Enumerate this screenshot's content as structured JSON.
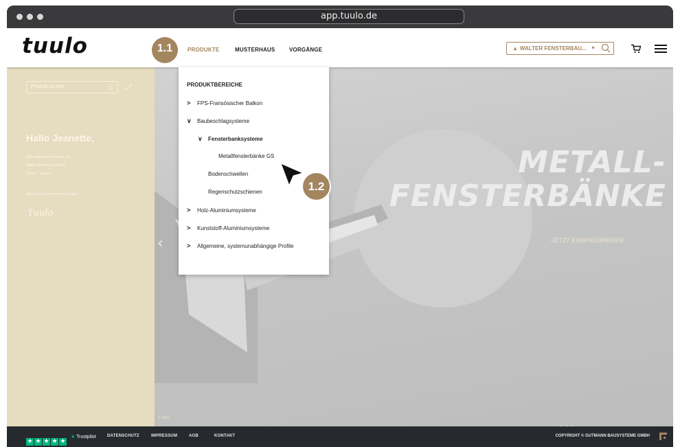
{
  "browser": {
    "url": "app.tuulo.de"
  },
  "header": {
    "logo": "tuulo",
    "step_badge": "1.1",
    "nav": [
      "PRODUKTE",
      "MUSTERHAUS",
      "VORGÄNGE"
    ],
    "user_select": {
      "value": "WALTER FENSTERBAU..."
    },
    "icons": [
      "person-icon",
      "caret-down-icon",
      "search-icon",
      "cart-icon",
      "menu-icon"
    ],
    "accent_color": "#a38660"
  },
  "sidebar": {
    "search_placeholder": "Produkt suchen",
    "greeting": "Hallo Jeanette,",
    "lines": [
      "dein ausgewählter Kunde ist:",
      "Walter Fensterbau GmbH",
      "Sorten · Stegen",
      "Viel Spaß in der neuen tuulo App!"
    ],
    "signature": "Tuulo",
    "footnote": "© 2020"
  },
  "hero": {
    "title_line1": "METALL-",
    "title_line2": "FENSTERBÄNKE",
    "cta": "JETZT KONFIGURIEREN",
    "slides": 3
  },
  "dropdown": {
    "heading": "PRODUKTBEREICHE",
    "items": [
      {
        "label": "FPS-Fransösischer Balkon",
        "icon": "chevron-right-icon"
      },
      {
        "label": "Baubeschlagsysteme",
        "icon": "chevron-down-icon"
      },
      {
        "label": "Fensterbanksysteme",
        "icon": "chevron-down-icon"
      },
      {
        "label": "Metallfensterbänke GS"
      },
      {
        "label": "Bodenschwellen"
      },
      {
        "label": "Regenschutzschienen"
      },
      {
        "label": "Holz-Aluminiumsysteme",
        "icon": "chevron-right-icon"
      },
      {
        "label": "Kunststoff-Aluminiumsysteme",
        "icon": "chevron-right-icon"
      },
      {
        "label": "Allgemeine, systemunabhängige Profile",
        "icon": "chevron-right-icon"
      }
    ]
  },
  "annotation": {
    "step_badge_2": "1.2"
  },
  "footer": {
    "trustpilot": "Trustpilot",
    "links": [
      "DATENSCHUTZ",
      "IMPRESSUM",
      "AGB",
      "KONTAKT"
    ],
    "copyright": "COPYRIGHT © GUTMANN BAUSYSTEME GMBH"
  }
}
